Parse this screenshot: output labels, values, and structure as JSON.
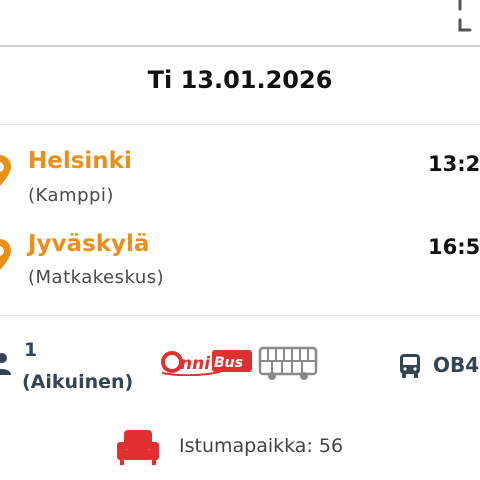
{
  "header": {
    "corner_icon": "fullscreen-corner-icon"
  },
  "trip": {
    "date": "Ti 13.01.2026",
    "departure": {
      "city": "Helsinki",
      "station": "(Kamppi)",
      "time": "13:2"
    },
    "arrival": {
      "city": "Jyväskylä",
      "station": "(Matkakeskus)",
      "time": "16:5"
    }
  },
  "passengers": {
    "count": "1",
    "type": "(Aikuinen)"
  },
  "operator": {
    "logo_text": "OnniBus",
    "icon": "double-decker-bus-icon"
  },
  "vehicle": {
    "icon": "bus-front-icon",
    "code": "OB4"
  },
  "seat": {
    "icon": "seat-icon",
    "label": "Istumapaikka: 56"
  },
  "colors": {
    "accent_orange": "#e8901a",
    "logo_red": "#e03030",
    "text_dark": "#111111",
    "text_slate": "#334455"
  }
}
